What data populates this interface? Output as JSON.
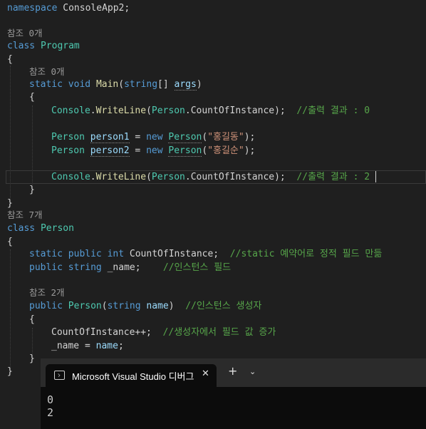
{
  "editor": {
    "lines": {
      "namespace_kw": "namespace",
      "namespace_name": "ConsoleApp2;",
      "ref_program": "참조 0개",
      "class_kw": "class",
      "program_name": "Program",
      "open_brace": "{",
      "close_brace": "}",
      "ref_main": "참조 0개",
      "main_static": "static",
      "main_void": "void",
      "main_name": "Main",
      "main_paren_open": "(",
      "main_string": "string",
      "main_brackets": "[] ",
      "main_args": "args",
      "main_paren_close": ")",
      "console": "Console",
      "dot": ".",
      "writeline": "WriteLine",
      "paren_open": "(",
      "person_type": "Person",
      "count_of_instance": "CountOfInstance",
      "writeline_end": ");",
      "comment_output_0": "//출력 결과 : 0",
      "comment_output_2": "//출력 결과 : 2",
      "person1_var": "person1",
      "person2_var": "person2",
      "assign": " = ",
      "new_kw": "new",
      "str_hong1": "\"홍길동\"",
      "str_hong2": "\"홍길순\"",
      "paren_close_semi": ");",
      "ref_person": "참조 7개",
      "person_class": "Person",
      "static_kw": "static",
      "public_kw": "public",
      "int_kw": "int",
      "field_count": "CountOfInstance;",
      "comment_static_field": "//static 예약어로 정적 필드 만듦",
      "string_kw": "string",
      "field_name": "_name;",
      "comment_instance_field": "//인스턴스 필드",
      "ref_ctor": "참조 2개",
      "ctor_name": "Person",
      "ctor_param": "name",
      "comment_ctor": "//인스턴스 생성자",
      "ctor_body_inc": "CountOfInstance++;",
      "comment_inc": "//생성자에서 필드 값 증가",
      "ctor_body_assign_left": "_name = ",
      "ctor_body_assign_right": "name",
      "semi": ";"
    }
  },
  "terminal": {
    "tab_title": "Microsoft Visual Studio 디버그",
    "close_glyph": "✕",
    "new_tab_glyph": "+",
    "dropdown_glyph": "⌄",
    "output": [
      "0",
      "2"
    ]
  },
  "colors": {
    "background": "#1f1f1f",
    "keyword": "#569cd6",
    "type": "#4ec9b0",
    "method": "#dcdcaa",
    "parameter": "#9cdcfe",
    "string": "#ce9178",
    "comment": "#57a64a"
  }
}
